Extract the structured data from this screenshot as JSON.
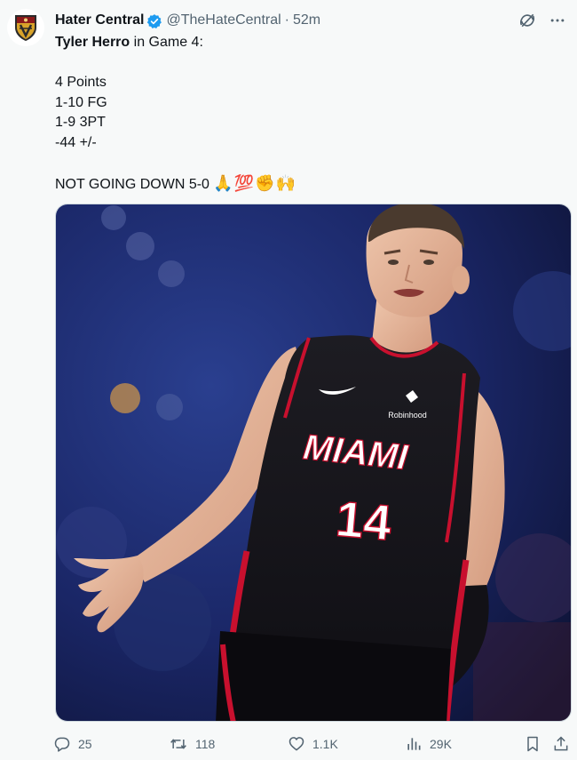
{
  "author": {
    "display_name": "Hater Central",
    "handle": "@TheHateCentral",
    "separator": "·",
    "time": "52m",
    "verified": true,
    "verified_color": "#1d9bf0"
  },
  "tweet": {
    "mention": "Tyler Herro",
    "line1_rest": " in Game 4:",
    "stat_points": "4 Points",
    "stat_fg": "1-10 FG",
    "stat_3pt": "1-9 3PT",
    "stat_pm": "-44 +/-",
    "closing_text": "NOT GOING DOWN 5-0 ",
    "closing_emoji": "🙏💯✊🙌"
  },
  "media": {
    "jersey_team": "MIAMI",
    "jersey_number": "14",
    "sponsor": "Robinhood"
  },
  "actions": {
    "replies": "25",
    "reposts": "118",
    "likes": "1.1K",
    "views": "29K"
  },
  "icons": {
    "header": [
      "grok-icon",
      "more-icon"
    ],
    "actions": [
      "reply-icon",
      "repost-icon",
      "like-icon",
      "views-icon",
      "bookmark-icon",
      "share-icon"
    ]
  },
  "colors": {
    "background": "#f7f9f9",
    "text": "#0f1419",
    "secondary": "#536471",
    "jersey_black": "#141318",
    "jersey_red": "#c8102e"
  }
}
